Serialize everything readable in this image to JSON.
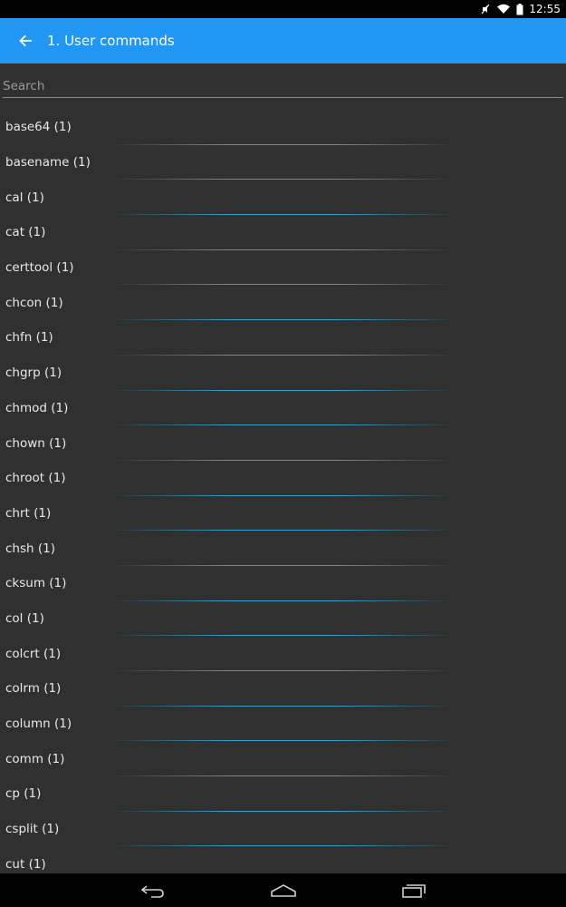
{
  "status_bar": {
    "time": "12:55"
  },
  "app_bar": {
    "title": "1. User commands"
  },
  "search": {
    "placeholder": "Search",
    "value": ""
  },
  "commands": [
    "base64 (1)",
    "basename (1)",
    "cal (1)",
    "cat (1)",
    "certtool (1)",
    "chcon (1)",
    "chfn (1)",
    "chgrp (1)",
    "chmod (1)",
    "chown (1)",
    "chroot (1)",
    "chrt (1)",
    "chsh (1)",
    "cksum (1)",
    "col (1)",
    "colcrt (1)",
    "colrm (1)",
    "column (1)",
    "comm (1)",
    "cp (1)",
    "csplit (1)",
    "cut (1)"
  ],
  "colors": {
    "accent": "#2196f3",
    "background": "#303030",
    "divider": "#33b5e5"
  }
}
